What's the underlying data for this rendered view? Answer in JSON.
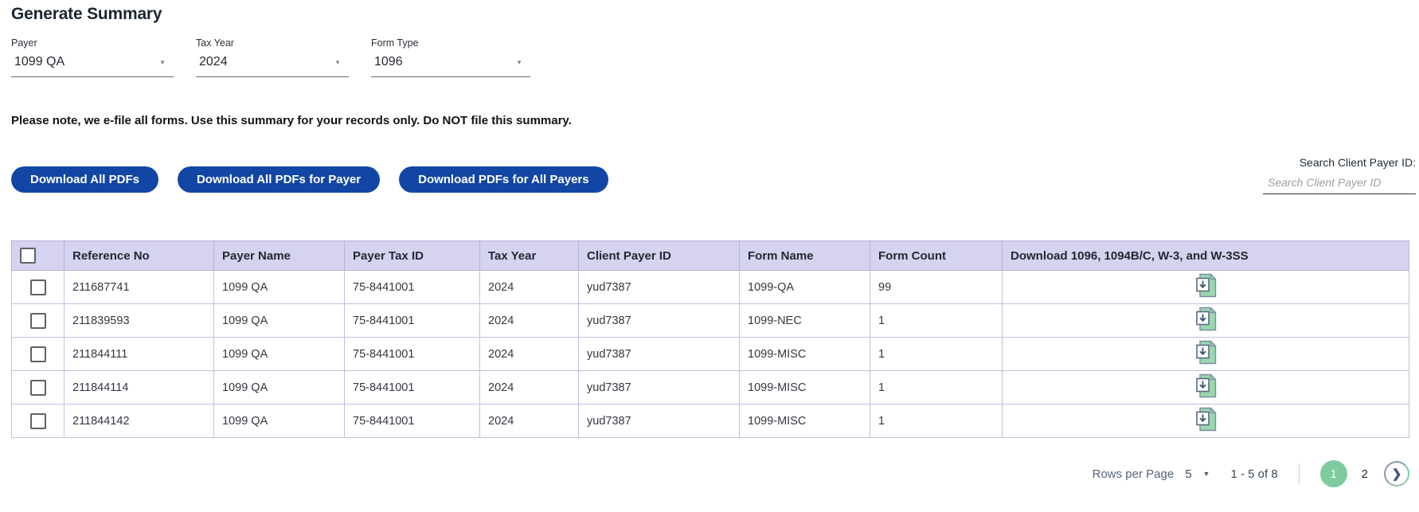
{
  "page": {
    "title": "Generate Summary"
  },
  "filters": {
    "payer": {
      "label": "Payer",
      "value": "1099 QA"
    },
    "tax_year": {
      "label": "Tax Year",
      "value": "2024"
    },
    "form_type": {
      "label": "Form Type",
      "value": "1096"
    }
  },
  "note": "Please note, we e-file all forms. Use this summary for your records only. Do NOT file this summary.",
  "buttons": {
    "download_all_pdfs": "Download All PDFs",
    "download_all_pdfs_for_payer": "Download All PDFs for Payer",
    "download_pdfs_for_all_payers": "Download PDFs for All Payers"
  },
  "search": {
    "label": "Search Client Payer ID:",
    "placeholder": "Search Client Payer ID"
  },
  "table": {
    "columns": [
      "Reference No",
      "Payer Name",
      "Payer Tax ID",
      "Tax Year",
      "Client Payer ID",
      "Form Name",
      "Form Count",
      "Download 1096, 1094B/C, W-3, and W-3SS"
    ],
    "rows": [
      {
        "reference_no": "211687741",
        "payer_name": "1099 QA",
        "payer_tax_id": "75-8441001",
        "tax_year": "2024",
        "client_payer_id": "yud7387",
        "form_name": "1099-QA",
        "form_count": "99"
      },
      {
        "reference_no": "211839593",
        "payer_name": "1099 QA",
        "payer_tax_id": "75-8441001",
        "tax_year": "2024",
        "client_payer_id": "yud7387",
        "form_name": "1099-NEC",
        "form_count": "1"
      },
      {
        "reference_no": "211844111",
        "payer_name": "1099 QA",
        "payer_tax_id": "75-8441001",
        "tax_year": "2024",
        "client_payer_id": "yud7387",
        "form_name": "1099-MISC",
        "form_count": "1"
      },
      {
        "reference_no": "211844114",
        "payer_name": "1099 QA",
        "payer_tax_id": "75-8441001",
        "tax_year": "2024",
        "client_payer_id": "yud7387",
        "form_name": "1099-MISC",
        "form_count": "1"
      },
      {
        "reference_no": "211844142",
        "payer_name": "1099 QA",
        "payer_tax_id": "75-8441001",
        "tax_year": "2024",
        "client_payer_id": "yud7387",
        "form_name": "1099-MISC",
        "form_count": "1"
      }
    ]
  },
  "pagination": {
    "rows_per_page_label": "Rows per Page",
    "rows_per_page_value": "5",
    "range_text": "1 - 5 of 8",
    "pages": [
      "1",
      "2"
    ],
    "active_page": "1",
    "next_glyph": "❯"
  },
  "icons": {
    "dropdown_caret": "▼",
    "download_file": "download-file-icon"
  },
  "colors": {
    "primary_button_blue": "#1246a5",
    "table_header_lavender": "#d5d3ef",
    "active_page_green": "#7ecb9d",
    "icon_green": "#9ad8b0"
  }
}
